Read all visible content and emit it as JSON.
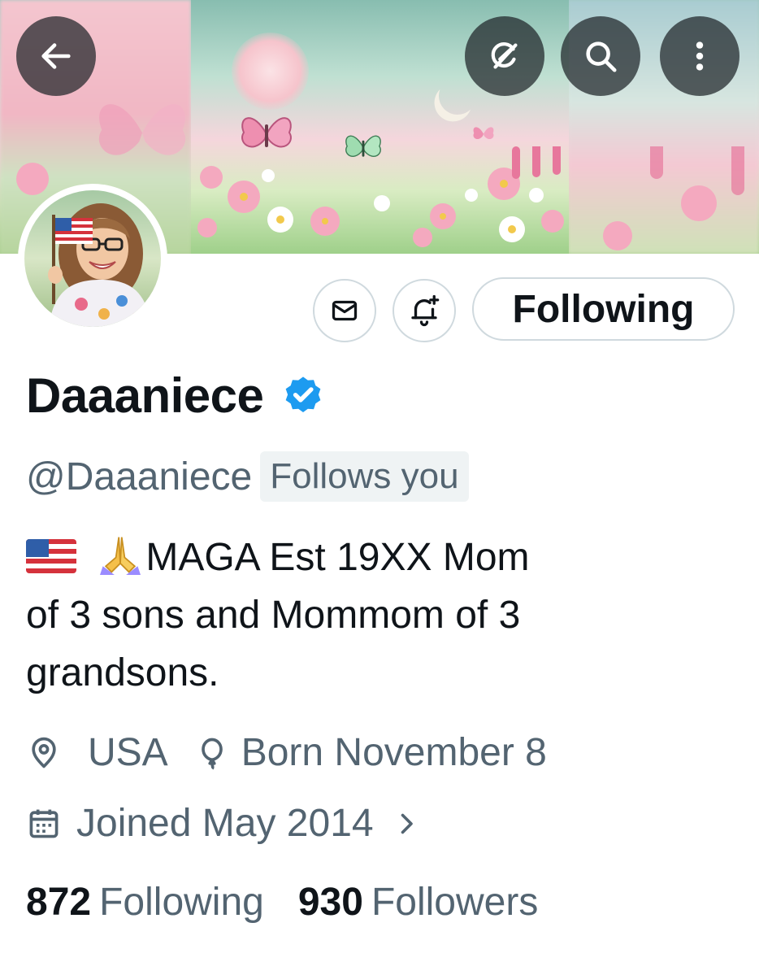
{
  "header": {
    "back_icon": "arrow-left-icon",
    "grok_icon": "grok-icon",
    "search_icon": "search-icon",
    "more_icon": "more-vertical-icon"
  },
  "profile": {
    "display_name": "Daaaniece",
    "verified": true,
    "handle": "@Daaaniece",
    "follows_you": "Follows you",
    "bio_emojis": [
      "🇺🇸",
      "🙏"
    ],
    "bio_line1": "MAGA Est 19XX Mom",
    "bio_line2": "of 3 sons and Mommom of 3",
    "bio_line3": "grandsons.",
    "location": "USA",
    "birthday": "Born November 8",
    "joined": "Joined May 2014"
  },
  "actions": {
    "message_icon": "envelope-icon",
    "notify_icon": "bell-plus-icon",
    "follow_label": "Following"
  },
  "stats": {
    "following_count": "872",
    "following_label": "Following",
    "followers_count": "930",
    "followers_label": "Followers"
  },
  "colors": {
    "primary_text": "#0f1419",
    "secondary_text": "#536471",
    "verified_blue": "#1d9bf0",
    "border": "#cfd9de",
    "chip_bg": "#eff3f4"
  }
}
